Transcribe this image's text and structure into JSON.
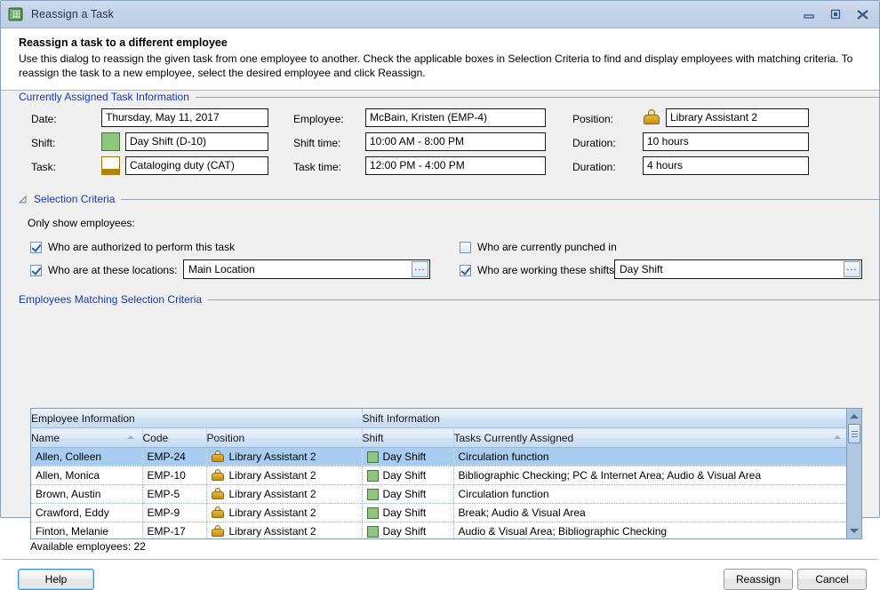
{
  "window": {
    "title": "Reassign a Task",
    "icon": "grid-app-icon",
    "controls": {
      "minimize": "minimize",
      "maximize": "maximize",
      "close": "close"
    }
  },
  "header": {
    "heading": "Reassign a task to a different employee",
    "description": "Use this dialog to reassign the given task from one employee to another.  Check the applicable boxes in Selection Criteria to find and display employees with matching criteria.  To reassign the task to a new employee, select the desired employee and click Reassign."
  },
  "task_info": {
    "caption": "Currently Assigned Task Information",
    "date_label": "Date:",
    "date_value": "Thursday, May 11, 2017",
    "shift_label": "Shift:",
    "shift_value": "Day Shift (D-10)",
    "shift_color": "#8cc77c",
    "task_label": "Task:",
    "task_value": "Cataloging duty (CAT)",
    "task_color": "#b5820c",
    "employee_label": "Employee:",
    "employee_value": "McBain, Kristen (EMP-4)",
    "shift_time_label": "Shift time:",
    "shift_time_value": "10:00 AM - 8:00 PM",
    "task_time_label": "Task time:",
    "task_time_value": "12:00 PM - 4:00 PM",
    "position_label": "Position:",
    "position_value": "Library Assistant 2",
    "shift_duration_label": "Duration:",
    "shift_duration_value": "10 hours",
    "task_duration_label": "Duration:",
    "task_duration_value": "4 hours"
  },
  "criteria": {
    "caption": "Selection Criteria",
    "intro": "Only show employees:",
    "authorized": {
      "label": "Who are authorized to perform this task",
      "checked": true
    },
    "punched_in": {
      "label": "Who are currently punched in",
      "checked": false
    },
    "locations": {
      "label": "Who are at these locations:",
      "checked": true,
      "value": "Main Location",
      "browse": "..."
    },
    "shifts": {
      "label": "Who are working these shifts:",
      "checked": true,
      "value": "Day Shift",
      "browse": "..."
    }
  },
  "results": {
    "caption": "Employees Matching Selection Criteria",
    "group_headers": {
      "employee": "Employee Information",
      "shift": "Shift Information"
    },
    "columns": [
      "Name",
      "Code",
      "Position",
      "Shift",
      "Tasks Currently Assigned"
    ],
    "sorted_column": "Name",
    "sort_direction": "ascending",
    "rows": [
      {
        "name": "Allen, Colleen",
        "code": "EMP-24",
        "position": "Library Assistant 2",
        "shift": "Day Shift",
        "shift_color": "#8cc77c",
        "tasks": "Circulation function",
        "selected": true
      },
      {
        "name": "Allen, Monica",
        "code": "EMP-10",
        "position": "Library Assistant 2",
        "shift": "Day Shift",
        "shift_color": "#8cc77c",
        "tasks": "Bibliographic Checking; PC & Internet Area; Audio & Visual Area",
        "selected": false
      },
      {
        "name": "Brown, Austin",
        "code": "EMP-5",
        "position": "Library Assistant 2",
        "shift": "Day Shift",
        "shift_color": "#8cc77c",
        "tasks": "Circulation function",
        "selected": false
      },
      {
        "name": "Crawford, Eddy",
        "code": "EMP-9",
        "position": "Library Assistant 2",
        "shift": "Day Shift",
        "shift_color": "#8cc77c",
        "tasks": "Break; Audio & Visual Area",
        "selected": false
      },
      {
        "name": "Finton, Melanie",
        "code": "EMP-17",
        "position": "Library Assistant 2",
        "shift": "Day Shift",
        "shift_color": "#8cc77c",
        "tasks": "Audio & Visual Area; Bibliographic Checking",
        "selected": false
      }
    ],
    "available_text": "Available employees: 22"
  },
  "footer": {
    "help": "Help",
    "reassign": "Reassign",
    "cancel": "Cancel"
  },
  "colors": {
    "titlebar": "#c3d2e8",
    "caption_blue": "#1638c8",
    "selection_blue": "#a8cdf0",
    "grid_header": "#cfe1f4",
    "dialog_bg": "#f0f0f0"
  }
}
